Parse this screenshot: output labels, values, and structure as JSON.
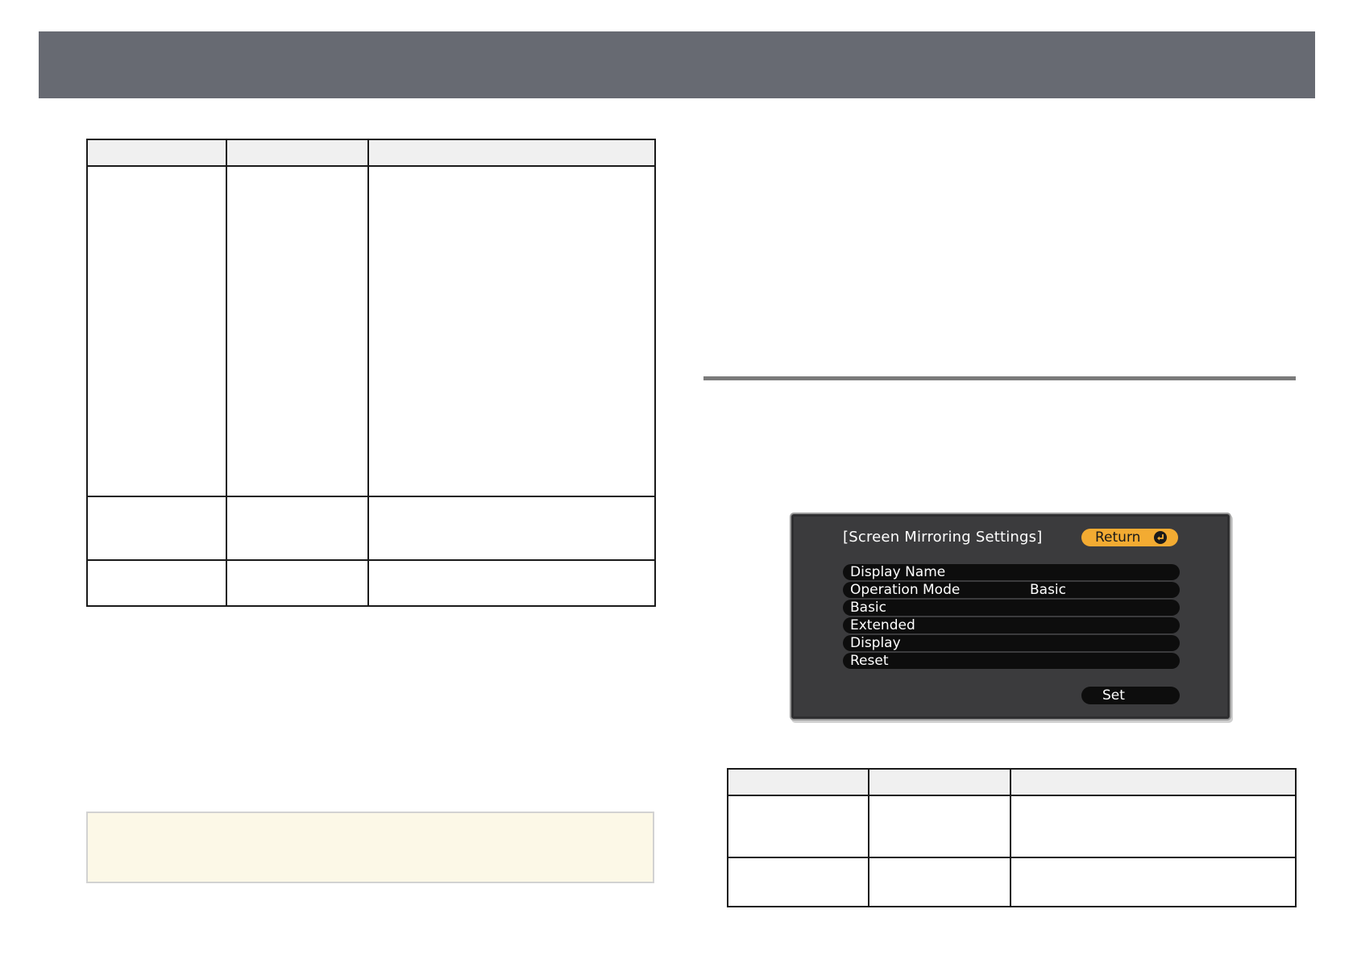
{
  "osd": {
    "title": "[Screen Mirroring Settings]",
    "return_label": "Return",
    "return_icon": "enter-icon",
    "menu_items": [
      {
        "label": "Display Name",
        "value": ""
      },
      {
        "label": "Operation Mode",
        "value": "Basic"
      },
      {
        "label": "Basic",
        "value": ""
      },
      {
        "label": "Extended",
        "value": ""
      },
      {
        "label": "Display",
        "value": ""
      },
      {
        "label": "Reset",
        "value": ""
      }
    ],
    "set_label": "Set",
    "colors": {
      "panel": "#3b3b3d",
      "item": "#0d0d0d",
      "return_button": "#f3ab32"
    }
  },
  "colors": {
    "header_bar": "#676a72",
    "table_header": "#f0f0f0",
    "note_background": "#fcf8e7",
    "section_rule": "#7b7b7b"
  }
}
